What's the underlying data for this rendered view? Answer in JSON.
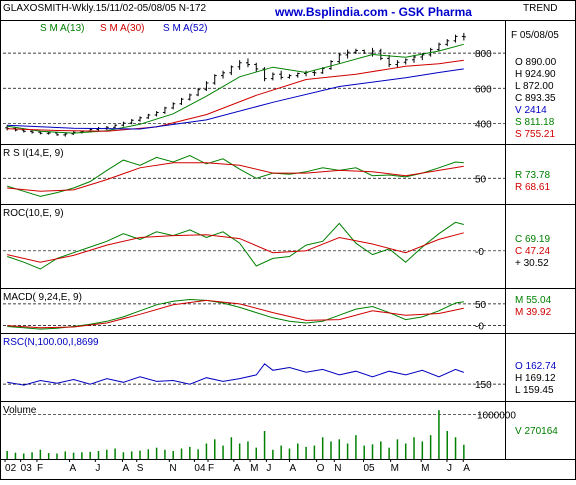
{
  "header": {
    "title": "GLAXOSMITH-Wkly.15/11/02-05/08/05  N-172",
    "site": "www.Bsplindia.com - GSK Pharma",
    "trend": "TREND"
  },
  "colors": {
    "background": "#ffffff",
    "grid": "#000000",
    "price": "#000000",
    "green": "#008000",
    "red": "#d00000",
    "blue": "#0000c0",
    "site": "#0000cc"
  },
  "chart_data": [
    {
      "type": "line",
      "panel": "price",
      "legend": [
        "S M A(13)",
        "S M A(30)",
        "S M A(52)"
      ],
      "y_ticks": [
        400,
        600,
        800
      ],
      "ylim": [
        300,
        960
      ],
      "x_domain": [
        0,
        56
      ],
      "info": {
        "date": "F 05/08/05",
        "rows": [
          "O  890.00",
          "H  924.90",
          "L  872.00",
          "C  893.35",
          "V  2414",
          "S  811.18",
          "S  755.21"
        ]
      },
      "bars": [
        [
          0,
          375,
          390,
          360,
          372
        ],
        [
          1,
          372,
          380,
          355,
          362
        ],
        [
          2,
          362,
          368,
          348,
          355
        ],
        [
          3,
          355,
          362,
          342,
          350
        ],
        [
          4,
          350,
          356,
          338,
          344
        ],
        [
          5,
          344,
          352,
          336,
          346
        ],
        [
          6,
          346,
          350,
          330,
          335
        ],
        [
          7,
          335,
          345,
          325,
          340
        ],
        [
          8,
          340,
          355,
          335,
          350
        ],
        [
          9,
          350,
          360,
          342,
          352
        ],
        [
          10,
          352,
          370,
          348,
          365
        ],
        [
          11,
          365,
          380,
          358,
          372
        ],
        [
          12,
          372,
          385,
          362,
          378
        ],
        [
          13,
          378,
          395,
          372,
          390
        ],
        [
          14,
          390,
          410,
          382,
          402
        ],
        [
          15,
          402,
          425,
          395,
          418
        ],
        [
          16,
          418,
          440,
          410,
          432
        ],
        [
          17,
          432,
          455,
          425,
          448
        ],
        [
          18,
          448,
          470,
          440,
          462
        ],
        [
          19,
          462,
          495,
          455,
          488
        ],
        [
          20,
          488,
          520,
          480,
          512
        ],
        [
          21,
          512,
          545,
          505,
          538
        ],
        [
          22,
          538,
          570,
          530,
          562
        ],
        [
          23,
          562,
          600,
          555,
          592
        ],
        [
          24,
          592,
          640,
          585,
          630
        ],
        [
          25,
          630,
          680,
          620,
          672
        ],
        [
          26,
          672,
          700,
          655,
          688
        ],
        [
          27,
          688,
          730,
          675,
          722
        ],
        [
          28,
          722,
          760,
          705,
          745
        ],
        [
          29,
          745,
          770,
          720,
          735
        ],
        [
          30,
          735,
          745,
          695,
          710
        ],
        [
          31,
          710,
          720,
          640,
          655
        ],
        [
          32,
          655,
          690,
          645,
          680
        ],
        [
          33,
          680,
          700,
          650,
          662
        ],
        [
          34,
          662,
          680,
          655,
          672
        ],
        [
          35,
          672,
          690,
          660,
          684
        ],
        [
          36,
          684,
          700,
          668,
          690
        ],
        [
          37,
          690,
          705,
          670,
          688
        ],
        [
          38,
          688,
          720,
          682,
          712
        ],
        [
          39,
          712,
          760,
          705,
          752
        ],
        [
          40,
          752,
          800,
          740,
          790
        ],
        [
          41,
          790,
          820,
          770,
          805
        ],
        [
          42,
          805,
          825,
          795,
          815
        ],
        [
          43,
          815,
          820,
          795,
          800
        ],
        [
          44,
          800,
          830,
          780,
          812
        ],
        [
          45,
          812,
          825,
          760,
          770
        ],
        [
          46,
          770,
          790,
          720,
          735
        ],
        [
          47,
          735,
          760,
          720,
          748
        ],
        [
          48,
          748,
          770,
          735,
          762
        ],
        [
          49,
          762,
          790,
          745,
          778
        ],
        [
          50,
          778,
          800,
          760,
          790
        ],
        [
          51,
          790,
          830,
          780,
          820
        ],
        [
          52,
          820,
          860,
          810,
          850
        ],
        [
          53,
          850,
          880,
          840,
          870
        ],
        [
          54,
          870,
          905,
          860,
          895
        ],
        [
          55,
          895,
          915,
          872,
          893
        ]
      ],
      "series": [
        {
          "name": "S M A(13)",
          "color": "#008000",
          "x": [
            0,
            4,
            8,
            12,
            16,
            20,
            24,
            28,
            32,
            36,
            40,
            44,
            48,
            52,
            55
          ],
          "values": [
            385,
            355,
            345,
            358,
            395,
            455,
            555,
            665,
            720,
            690,
            740,
            792,
            776,
            812,
            850
          ]
        },
        {
          "name": "S M A(30)",
          "color": "#d00000",
          "x": [
            0,
            6,
            12,
            18,
            24,
            30,
            36,
            42,
            48,
            52,
            55
          ],
          "values": [
            370,
            360,
            355,
            380,
            450,
            560,
            650,
            680,
            725,
            740,
            760
          ]
        },
        {
          "name": "S M A(52)",
          "color": "#0000c0",
          "x": [
            0,
            8,
            16,
            24,
            32,
            40,
            48,
            52,
            55
          ],
          "values": [
            390,
            372,
            368,
            420,
            520,
            610,
            660,
            690,
            710
          ]
        }
      ]
    },
    {
      "type": "line",
      "panel": "rsi",
      "label": "R S I(14,E, 9)",
      "y_ticks": [
        50
      ],
      "ylim": [
        15,
        95
      ],
      "x_domain": [
        0,
        56
      ],
      "info": [
        "R  73.78",
        "R  68.61"
      ],
      "series": [
        {
          "name": "RSI",
          "color": "#008000",
          "x": [
            0,
            2,
            4,
            6,
            8,
            10,
            12,
            14,
            16,
            18,
            20,
            22,
            24,
            26,
            28,
            30,
            32,
            34,
            36,
            38,
            40,
            42,
            44,
            46,
            48,
            50,
            52,
            54,
            55
          ],
          "values": [
            38,
            30,
            22,
            28,
            35,
            45,
            62,
            78,
            70,
            82,
            75,
            85,
            72,
            80,
            64,
            50,
            58,
            56,
            60,
            66,
            62,
            66,
            54,
            55,
            52,
            58,
            66,
            75,
            73.78
          ]
        },
        {
          "name": "Signal",
          "color": "#d00000",
          "x": [
            0,
            4,
            8,
            12,
            16,
            20,
            24,
            28,
            32,
            36,
            40,
            44,
            48,
            52,
            55
          ],
          "values": [
            35,
            30,
            32,
            48,
            66,
            74,
            74,
            70,
            58,
            58,
            62,
            60,
            54,
            62,
            68.61
          ]
        }
      ]
    },
    {
      "type": "line",
      "panel": "roc",
      "label": "ROC(10,E, 9)",
      "y_ticks": [
        0
      ],
      "ylim": [
        -90,
        110
      ],
      "x_domain": [
        0,
        56
      ],
      "info": [
        "C  69.19",
        "C  47.24",
        "+  30.52"
      ],
      "series": [
        {
          "name": "ROC",
          "color": "#008000",
          "x": [
            0,
            2,
            4,
            6,
            8,
            10,
            12,
            14,
            16,
            18,
            20,
            22,
            24,
            26,
            28,
            30,
            32,
            34,
            36,
            38,
            40,
            42,
            44,
            46,
            48,
            50,
            52,
            54,
            55
          ],
          "values": [
            -15,
            -30,
            -48,
            -20,
            -5,
            10,
            25,
            45,
            30,
            50,
            40,
            55,
            35,
            50,
            20,
            -40,
            -20,
            -15,
            15,
            25,
            72,
            20,
            -10,
            5,
            -30,
            10,
            45,
            75,
            69.19
          ]
        },
        {
          "name": "Signal",
          "color": "#d00000",
          "x": [
            0,
            4,
            8,
            12,
            16,
            20,
            24,
            28,
            32,
            36,
            40,
            44,
            48,
            52,
            55
          ],
          "values": [
            -10,
            -30,
            -12,
            15,
            35,
            40,
            42,
            32,
            -5,
            0,
            35,
            18,
            -5,
            30,
            47.24
          ]
        }
      ]
    },
    {
      "type": "line",
      "panel": "macd",
      "label": "MACD( 9,24,E, 9)",
      "y_ticks": [
        50,
        0
      ],
      "ylim": [
        -10,
        75
      ],
      "x_domain": [
        0,
        56
      ],
      "info": [
        "M  55.04",
        "M  39.92"
      ],
      "series": [
        {
          "name": "MACD",
          "color": "#008000",
          "x": [
            0,
            2,
            4,
            6,
            8,
            10,
            12,
            14,
            16,
            18,
            20,
            22,
            24,
            26,
            28,
            30,
            32,
            34,
            36,
            38,
            40,
            42,
            44,
            46,
            48,
            50,
            52,
            54,
            55
          ],
          "values": [
            -2,
            -5,
            -8,
            -6,
            -2,
            3,
            10,
            20,
            34,
            48,
            56,
            60,
            58,
            52,
            42,
            30,
            18,
            10,
            6,
            10,
            24,
            38,
            44,
            30,
            14,
            20,
            34,
            52,
            55.04
          ]
        },
        {
          "name": "Signal",
          "color": "#d00000",
          "x": [
            0,
            4,
            8,
            12,
            16,
            20,
            24,
            28,
            32,
            36,
            40,
            44,
            48,
            52,
            55
          ],
          "values": [
            0,
            -5,
            -3,
            6,
            26,
            48,
            58,
            50,
            30,
            12,
            14,
            34,
            24,
            28,
            39.92
          ]
        }
      ]
    },
    {
      "type": "line",
      "panel": "rsc",
      "label": "RSC(N,100.00,I,8699",
      "y_ticks": [
        150
      ],
      "ylim": [
        135,
        200
      ],
      "x_domain": [
        0,
        56
      ],
      "info": [
        "O  162.74",
        "H  169.12",
        "L  159.45"
      ],
      "series": [
        {
          "name": "RSC",
          "color": "#0000c0",
          "x": [
            0,
            2,
            4,
            6,
            8,
            10,
            12,
            14,
            16,
            18,
            20,
            22,
            24,
            26,
            28,
            30,
            31,
            32,
            34,
            36,
            38,
            40,
            42,
            44,
            46,
            48,
            50,
            52,
            54,
            55
          ],
          "values": [
            152,
            149,
            154,
            151,
            155,
            150,
            156,
            152,
            158,
            153,
            154,
            150,
            157,
            153,
            156,
            160,
            172,
            165,
            168,
            163,
            166,
            160,
            164,
            158,
            164,
            160,
            165,
            158,
            166,
            162.74
          ]
        }
      ]
    },
    {
      "type": "bar",
      "panel": "volume",
      "label": "Volume",
      "y_ticks": [
        1000000
      ],
      "ylim": [
        0,
        1200000
      ],
      "x_domain": [
        0,
        56
      ],
      "info": [
        "V  270164"
      ],
      "x": [
        0,
        1,
        2,
        3,
        4,
        5,
        6,
        7,
        8,
        9,
        10,
        11,
        12,
        13,
        14,
        15,
        16,
        17,
        18,
        19,
        20,
        21,
        22,
        23,
        24,
        25,
        26,
        27,
        28,
        29,
        30,
        31,
        32,
        33,
        34,
        35,
        36,
        37,
        38,
        39,
        40,
        41,
        42,
        43,
        44,
        45,
        46,
        47,
        48,
        49,
        50,
        51,
        52,
        53,
        54,
        55
      ],
      "values": [
        120000,
        80000,
        60000,
        90000,
        150000,
        70000,
        60000,
        110000,
        80000,
        90000,
        100000,
        120000,
        150000,
        180000,
        90000,
        110000,
        130000,
        160000,
        200000,
        150000,
        120000,
        180000,
        220000,
        160000,
        300000,
        400000,
        250000,
        450000,
        300000,
        350000,
        200000,
        600000,
        150000,
        250000,
        180000,
        300000,
        220000,
        250000,
        450000,
        350000,
        400000,
        300000,
        500000,
        250000,
        280000,
        350000,
        200000,
        400000,
        300000,
        450000,
        350000,
        500000,
        1100000,
        600000,
        450000,
        270164
      ]
    }
  ],
  "x_axis": {
    "labels": [
      {
        "text": "02",
        "x": 0.3
      },
      {
        "text": "03",
        "x": 2.6
      },
      {
        "text": "F",
        "x": 5
      },
      {
        "text": "A",
        "x": 9.8
      },
      {
        "text": "J",
        "x": 13.6
      },
      {
        "text": "A",
        "x": 17.6
      },
      {
        "text": "S",
        "x": 19.7
      },
      {
        "text": "N",
        "x": 24.5
      },
      {
        "text": "04",
        "x": 28.2
      },
      {
        "text": "F",
        "x": 30.2
      },
      {
        "text": "A",
        "x": 34
      },
      {
        "text": "M",
        "x": 36.4
      },
      {
        "text": "J",
        "x": 38.8
      },
      {
        "text": "A",
        "x": 42.2
      },
      {
        "text": "O",
        "x": 46.2
      },
      {
        "text": "N",
        "x": 48.8
      },
      {
        "text": "05",
        "x": 53.1
      },
      {
        "text": "M",
        "x": 57.1
      },
      {
        "text": "M",
        "x": 61.6
      },
      {
        "text": "J",
        "x": 65.4
      },
      {
        "text": "A",
        "x": 67.8
      }
    ]
  }
}
